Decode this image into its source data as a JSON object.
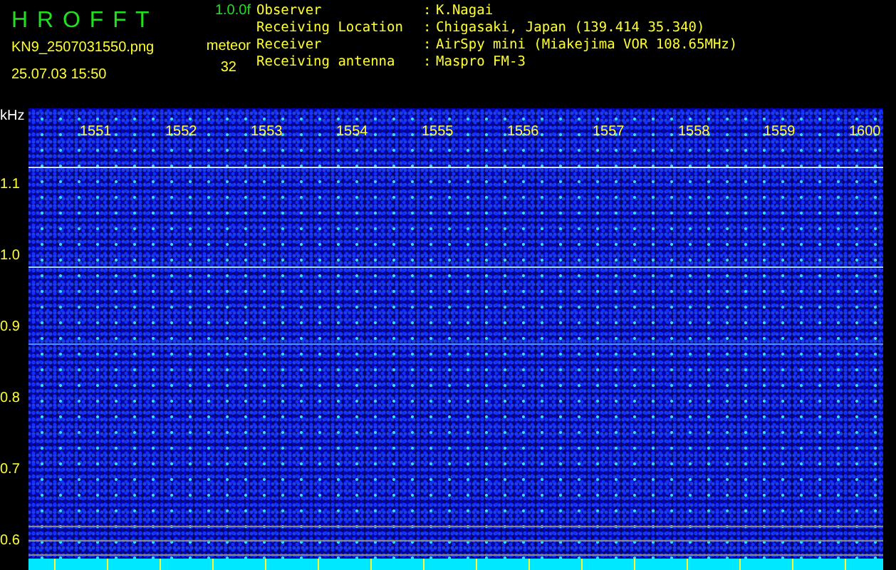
{
  "header": {
    "title": "H R O F F T",
    "version": "1.0.0f",
    "file_name": "KN9_2507031550.png",
    "mode": "meteor",
    "timestamp": "25.07.03 15:50",
    "count": "32"
  },
  "station_info": [
    {
      "label": "Observer",
      "separator": ":",
      "value": "K.Nagai"
    },
    {
      "label": "Receiving Location",
      "separator": ":",
      "value": "Chigasaki, Japan (139.414 35.340)"
    },
    {
      "label": "Receiver",
      "separator": ":",
      "value": "AirSpy mini (Miakejima VOR 108.65MHz)"
    },
    {
      "label": "Receiving antenna",
      "separator": ":",
      "value": "Maspro FM-3"
    }
  ],
  "y_axis": {
    "unit": "kHz",
    "labels": [
      "1.1",
      "1.0",
      "0.9",
      "0.8",
      "0.7",
      "0.6"
    ]
  },
  "x_axis": {
    "labels": [
      "1551",
      "1552",
      "1553",
      "1554",
      "1555",
      "1556",
      "1557",
      "1558",
      "1559",
      "1600"
    ]
  }
}
